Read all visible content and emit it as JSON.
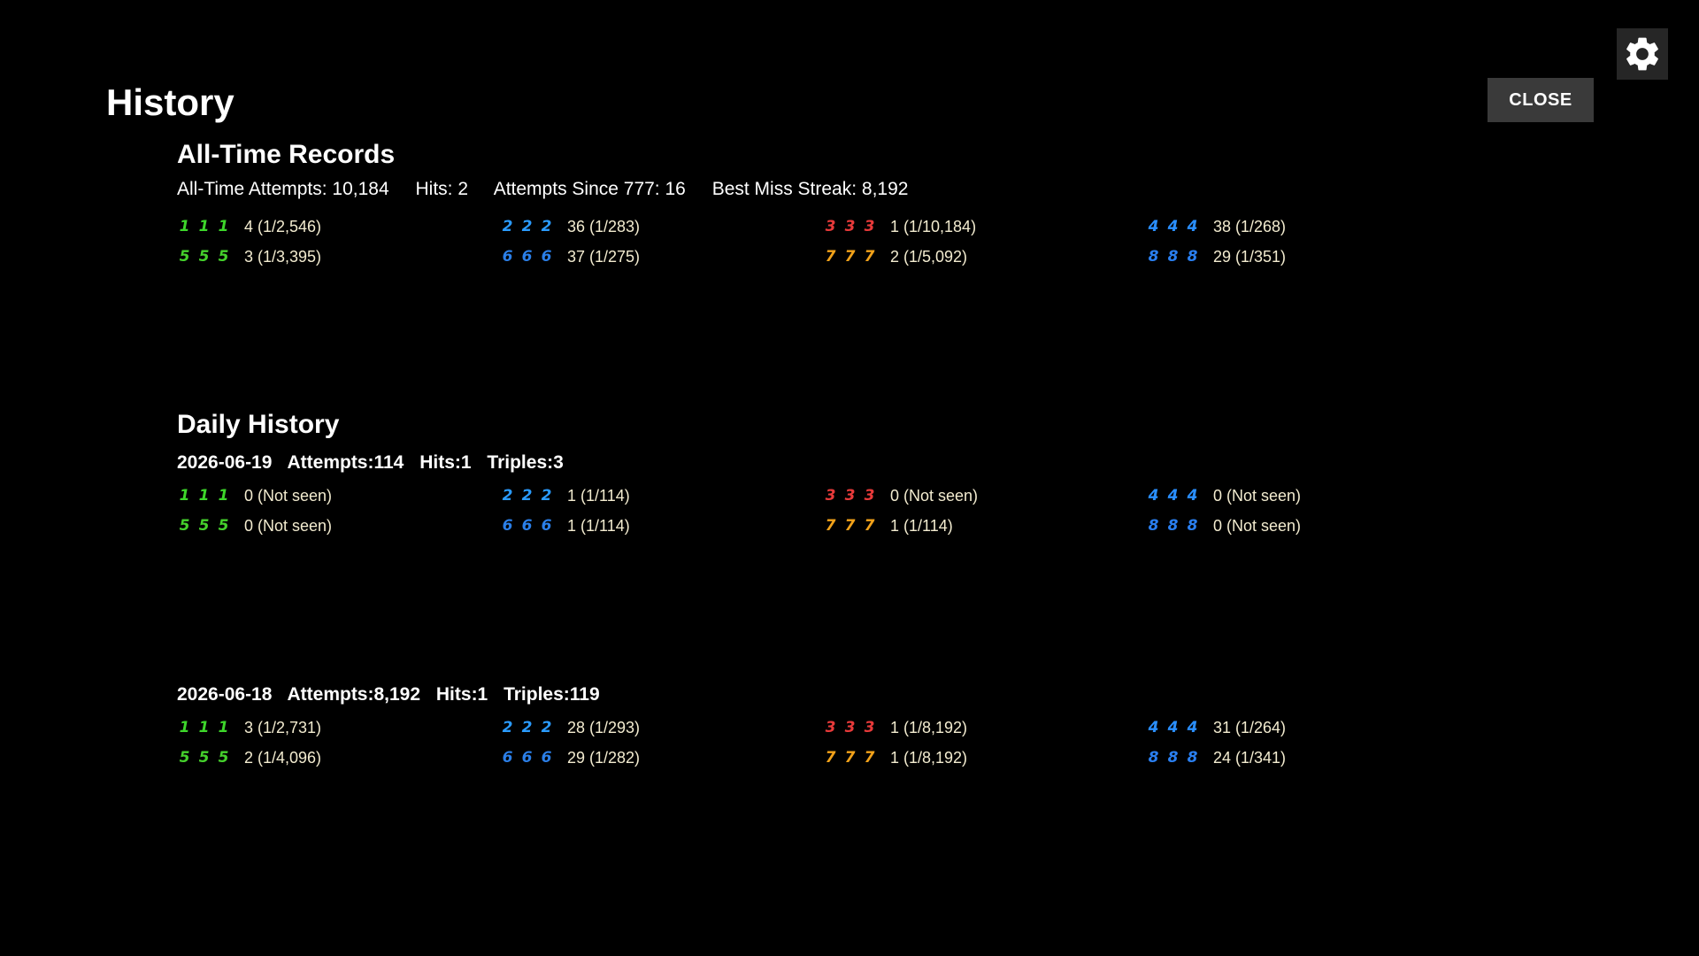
{
  "header": {
    "title": "History",
    "close_label": "CLOSE",
    "settings_icon": "gear-icon"
  },
  "alltime": {
    "title": "All-Time Records",
    "attempts": "All-Time Attempts: 10,184",
    "hits": "Hits: 2",
    "since777": "Attempts Since 777: 16",
    "best_streak": "Best Miss Streak: 8,192",
    "stats": [
      {
        "symbol": "1",
        "color": "#3dd62a",
        "text": "4 (1/2,546)"
      },
      {
        "symbol": "5",
        "color": "#45d12c",
        "text": "3 (1/3,395)"
      },
      {
        "symbol": "2",
        "color": "#2a9bff",
        "text": "36 (1/283)"
      },
      {
        "symbol": "6",
        "color": "#2b7fe8",
        "text": "37 (1/275)"
      },
      {
        "symbol": "3",
        "color": "#e83a3a",
        "text": "1 (1/10,184)"
      },
      {
        "symbol": "7",
        "color": "#f2a21a",
        "text": "2 (1/5,092)"
      },
      {
        "symbol": "4",
        "color": "#2a8fff",
        "text": "38 (1/268)"
      },
      {
        "symbol": "8",
        "color": "#2a7ff0",
        "text": "29 (1/351)"
      }
    ]
  },
  "daily": {
    "title": "Daily History",
    "days": [
      {
        "date": "2026-06-19",
        "attempts": "Attempts:114",
        "hits": "Hits:1",
        "triples": "Triples:3",
        "stats": [
          {
            "symbol": "1",
            "color": "#3dd62a",
            "text": "0 (Not seen)"
          },
          {
            "symbol": "5",
            "color": "#45d12c",
            "text": "0 (Not seen)"
          },
          {
            "symbol": "2",
            "color": "#2a9bff",
            "text": "1 (1/114)"
          },
          {
            "symbol": "6",
            "color": "#2b7fe8",
            "text": "1 (1/114)"
          },
          {
            "symbol": "3",
            "color": "#e83a3a",
            "text": "0 (Not seen)"
          },
          {
            "symbol": "7",
            "color": "#f2a21a",
            "text": "1 (1/114)"
          },
          {
            "symbol": "4",
            "color": "#2a8fff",
            "text": "0 (Not seen)"
          },
          {
            "symbol": "8",
            "color": "#2a7ff0",
            "text": "0 (Not seen)"
          }
        ]
      },
      {
        "date": "2026-06-18",
        "attempts": "Attempts:8,192",
        "hits": "Hits:1",
        "triples": "Triples:119",
        "stats": [
          {
            "symbol": "1",
            "color": "#3dd62a",
            "text": "3 (1/2,731)"
          },
          {
            "symbol": "5",
            "color": "#45d12c",
            "text": "2 (1/4,096)"
          },
          {
            "symbol": "2",
            "color": "#2a9bff",
            "text": "28 (1/293)"
          },
          {
            "symbol": "6",
            "color": "#2b7fe8",
            "text": "29 (1/282)"
          },
          {
            "symbol": "3",
            "color": "#e83a3a",
            "text": "1 (1/8,192)"
          },
          {
            "symbol": "7",
            "color": "#f2a21a",
            "text": "1 (1/8,192)"
          },
          {
            "symbol": "4",
            "color": "#2a8fff",
            "text": "31 (1/264)"
          },
          {
            "symbol": "8",
            "color": "#2a7ff0",
            "text": "24 (1/341)"
          }
        ]
      }
    ]
  }
}
